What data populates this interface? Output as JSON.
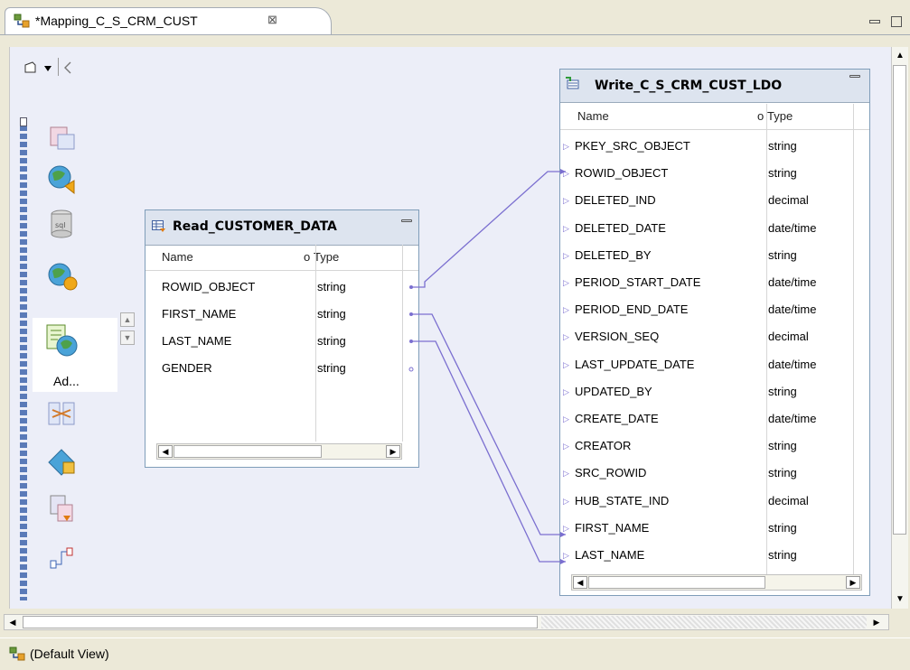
{
  "editor": {
    "tab_title": "*Mapping_C_S_CRM_CUST",
    "close_glyph": "⊠",
    "minimize_glyph": "▭",
    "maximize_glyph": "□"
  },
  "palette": {
    "selected_label": "Ad...",
    "icons": [
      "source-icon",
      "web-service-icon",
      "sql-icon",
      "transformation-icon",
      "address-validator-icon",
      "join-icon",
      "security-icon",
      "export-icon",
      "connector-icon"
    ]
  },
  "read_object": {
    "title": "Read_CUSTOMER_DATA",
    "col_name": "Name",
    "col_type": "Type",
    "rows": [
      {
        "name": "ROWID_OBJECT",
        "type": "string"
      },
      {
        "name": "FIRST_NAME",
        "type": "string"
      },
      {
        "name": "LAST_NAME",
        "type": "string"
      },
      {
        "name": "GENDER",
        "type": "string"
      }
    ]
  },
  "write_object": {
    "title": "Write_C_S_CRM_CUST_LDO",
    "col_name": "Name",
    "col_type": "Type",
    "rows": [
      {
        "name": "PKEY_SRC_OBJECT",
        "type": "string"
      },
      {
        "name": "ROWID_OBJECT",
        "type": "string"
      },
      {
        "name": "DELETED_IND",
        "type": "decimal"
      },
      {
        "name": "DELETED_DATE",
        "type": "date/time"
      },
      {
        "name": "DELETED_BY",
        "type": "string"
      },
      {
        "name": "PERIOD_START_DATE",
        "type": "date/time"
      },
      {
        "name": "PERIOD_END_DATE",
        "type": "date/time"
      },
      {
        "name": "VERSION_SEQ",
        "type": "decimal"
      },
      {
        "name": "LAST_UPDATE_DATE",
        "type": "date/time"
      },
      {
        "name": "UPDATED_BY",
        "type": "string"
      },
      {
        "name": "CREATE_DATE",
        "type": "date/time"
      },
      {
        "name": "CREATOR",
        "type": "string"
      },
      {
        "name": "SRC_ROWID",
        "type": "string"
      },
      {
        "name": "HUB_STATE_IND",
        "type": "decimal"
      },
      {
        "name": "FIRST_NAME",
        "type": "string"
      },
      {
        "name": "LAST_NAME",
        "type": "string"
      }
    ]
  },
  "status": {
    "view_label": "(Default View)"
  },
  "colors": {
    "link": "#7b6fd0",
    "header_bg": "#dde4ef",
    "canvas_bg": "#eceef8"
  }
}
